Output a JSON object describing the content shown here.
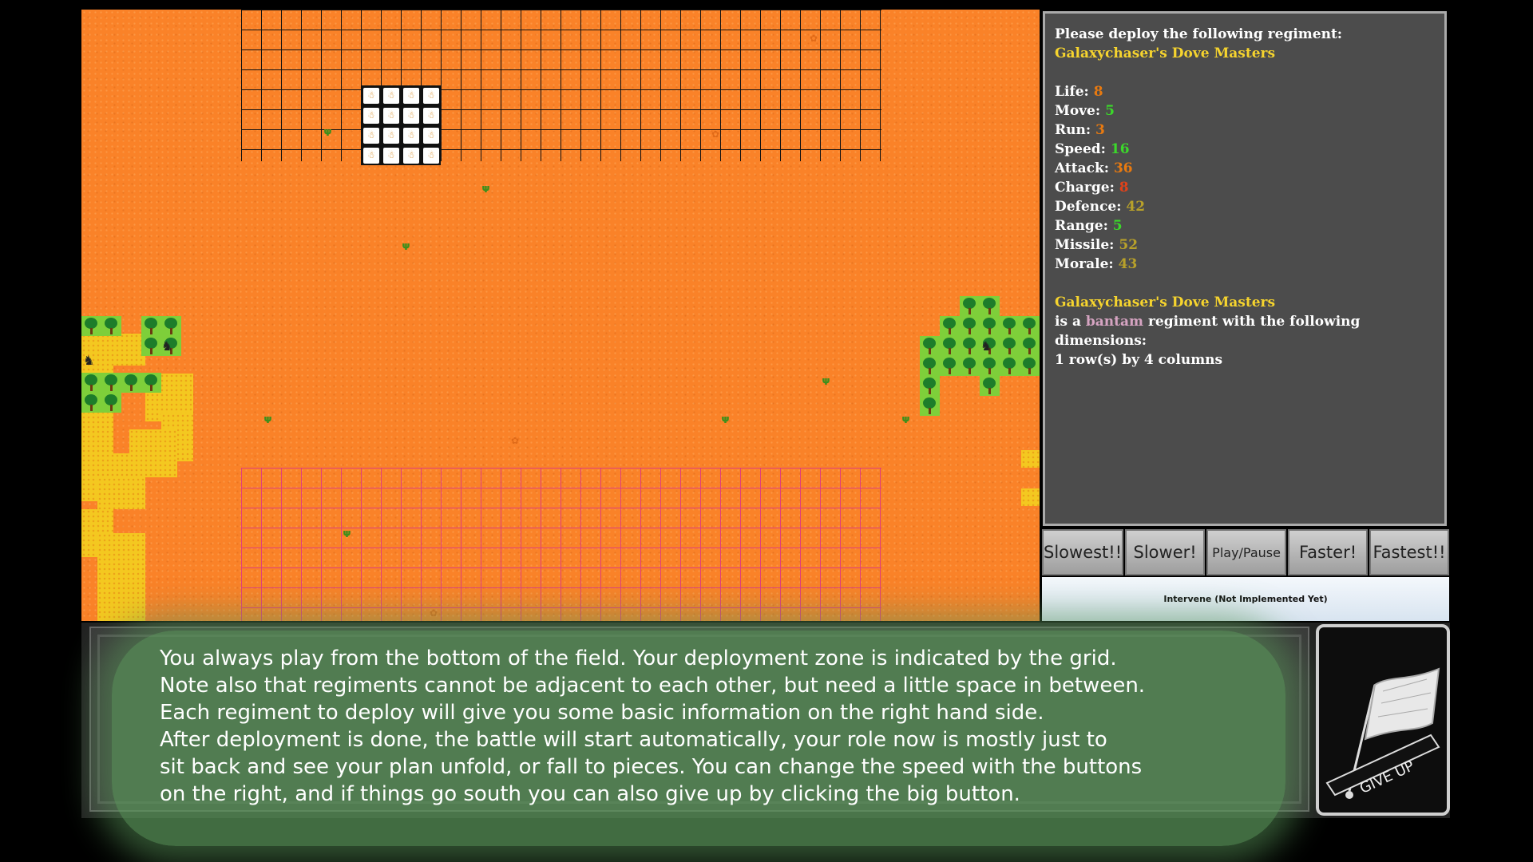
{
  "info_panel": {
    "prompt": "Please deploy the following regiment:",
    "regiment_name": "Galaxychaser's Dove Masters",
    "stats": [
      {
        "label": "Life:",
        "value": "8",
        "color": "#e87a10"
      },
      {
        "label": "Move:",
        "value": "5",
        "color": "#3bd82a"
      },
      {
        "label": "Run:",
        "value": "3",
        "color": "#e87a10"
      },
      {
        "label": "Speed:",
        "value": "16",
        "color": "#3bd82a"
      },
      {
        "label": "Attack:",
        "value": "36",
        "color": "#e87a10"
      },
      {
        "label": "Charge:",
        "value": "8",
        "color": "#e0421a"
      },
      {
        "label": "Defence:",
        "value": "42",
        "color": "#b8a12a"
      },
      {
        "label": "Range:",
        "value": "5",
        "color": "#3bd82a"
      },
      {
        "label": "Missile:",
        "value": "52",
        "color": "#b8a12a"
      },
      {
        "label": "Morale:",
        "value": "43",
        "color": "#b8a12a"
      }
    ],
    "desc_prefix": "is a",
    "regiment_type": "bantam",
    "desc_suffix": "regiment with the following dimensions:",
    "dimensions": "1 row(s) by 4 columns"
  },
  "speed_controls": {
    "slowest": "Slowest!!",
    "slower": "Slower!",
    "play_pause": "Play/Pause",
    "faster": "Faster!",
    "fastest": "Fastest!!"
  },
  "intervene_label": "Intervene (Not Implemented Yet)",
  "tutorial_lines": [
    "You always play from the bottom of the field. Your deployment zone is indicated by the grid.",
    "Note also that regiments cannot be adjacent to each other, but need a little space in between.",
    "Each regiment to deploy will give you some basic information on the right hand side.",
    "After deployment is done, the battle will start automatically, your role now is mostly just to",
    "sit back and see your plan unfold, or fall to pieces. You can change the speed with the buttons",
    "on the right, and if things go south you can also give up by clicking the big button."
  ],
  "give_up_label": "GIVE UP",
  "colors": {
    "field": "#fa8228",
    "sand": "#f4c820",
    "player_grid": "#e0407a",
    "enemy_grid": "#111111",
    "highlight": "#f6d42e"
  },
  "icons": {
    "soldier": "dove-soldier-icon",
    "forest": "tree-icon",
    "beast": "beast-icon",
    "flag": "white-flag-icon"
  }
}
